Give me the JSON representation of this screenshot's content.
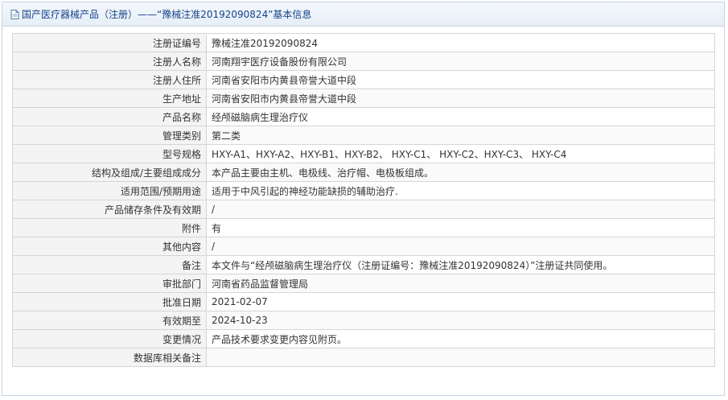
{
  "header": {
    "icon": "document-icon",
    "title": "国产医疗器械产品（注册）——“豫械注准20192090824”基本信息"
  },
  "rows": [
    {
      "label": "注册证编号",
      "value": "豫械注准20192090824"
    },
    {
      "label": "注册人名称",
      "value": "河南翔宇医疗设备股份有限公司"
    },
    {
      "label": "注册人住所",
      "value": "河南省安阳市内黄县帝誉大道中段"
    },
    {
      "label": "生产地址",
      "value": "河南省安阳市内黄县帝誉大道中段"
    },
    {
      "label": "产品名称",
      "value": "经颅磁脑病生理治疗仪"
    },
    {
      "label": "管理类别",
      "value": "第二类"
    },
    {
      "label": "型号规格",
      "value": "HXY-A1、HXY-A2、HXY-B1、HXY-B2、 HXY-C1、 HXY-C2、HXY-C3、 HXY-C4"
    },
    {
      "label": "结构及组成/主要组成成分",
      "value": "本产品主要由主机、电极线、治疗帽、电极板组成。"
    },
    {
      "label": "适用范围/预期用途",
      "value": "适用于中风引起的神经功能缺损的辅助治疗."
    },
    {
      "label": "产品储存条件及有效期",
      "value": "/"
    },
    {
      "label": "附件",
      "value": "有"
    },
    {
      "label": "其他内容",
      "value": "/"
    },
    {
      "label": "备注",
      "value": "本文件与“经颅磁脑病生理治疗仪（注册证编号：豫械注准20192090824）”注册证共同使用。"
    },
    {
      "label": "审批部门",
      "value": "河南省药品监督管理局"
    },
    {
      "label": "批准日期",
      "value": "2021-02-07"
    },
    {
      "label": "有效期至",
      "value": "2024-10-23"
    },
    {
      "label": "变更情况",
      "value": "产品技术要求变更内容见附页。"
    },
    {
      "label": "数据库相关备注",
      "value": ""
    }
  ]
}
